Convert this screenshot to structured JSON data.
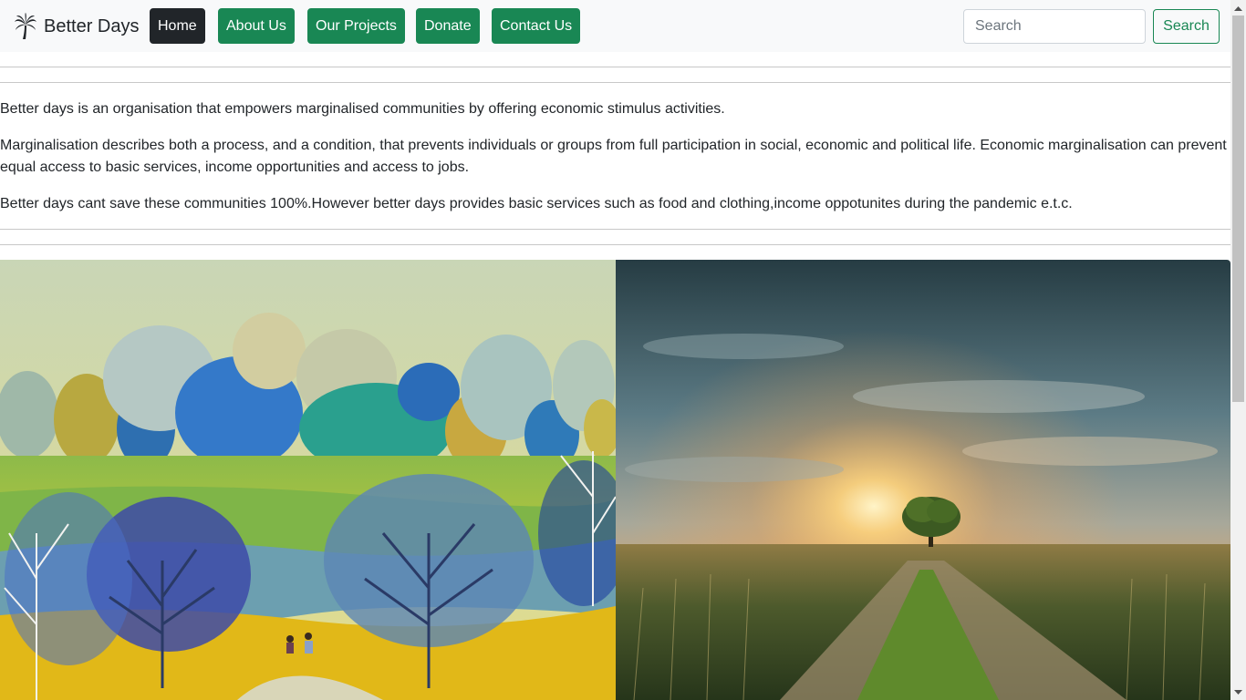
{
  "navbar": {
    "brand": "Better Days",
    "brand_icon": "palm-tree-icon",
    "links": [
      {
        "label": "Home",
        "active": true
      },
      {
        "label": "About Us",
        "active": false
      },
      {
        "label": "Our Projects",
        "active": false
      },
      {
        "label": "Donate",
        "active": false
      },
      {
        "label": "Contact Us",
        "active": false
      }
    ],
    "search_placeholder": "Search",
    "search_button": "Search"
  },
  "content": {
    "paragraphs": [
      "Better days is an organisation that empowers marginalised communities by offering economic stimulus activities.",
      "Marginalisation describes both a process, and a condition, that prevents individuals or groups from full participation in social, economic and political life. Economic marginalisation can prevent equal access to basic services, income opportunities and access to jobs.",
      "Better days cant save these communities 100%.However better days provides basic services such as food and clothing,income oppotunites during the pandemic e.t.c."
    ]
  },
  "images": [
    {
      "name": "painted-forest-image"
    },
    {
      "name": "sunset-field-image"
    }
  ],
  "colors": {
    "primary_green": "#198754",
    "dark": "#212529",
    "navbar_bg": "#f8f9fa"
  }
}
